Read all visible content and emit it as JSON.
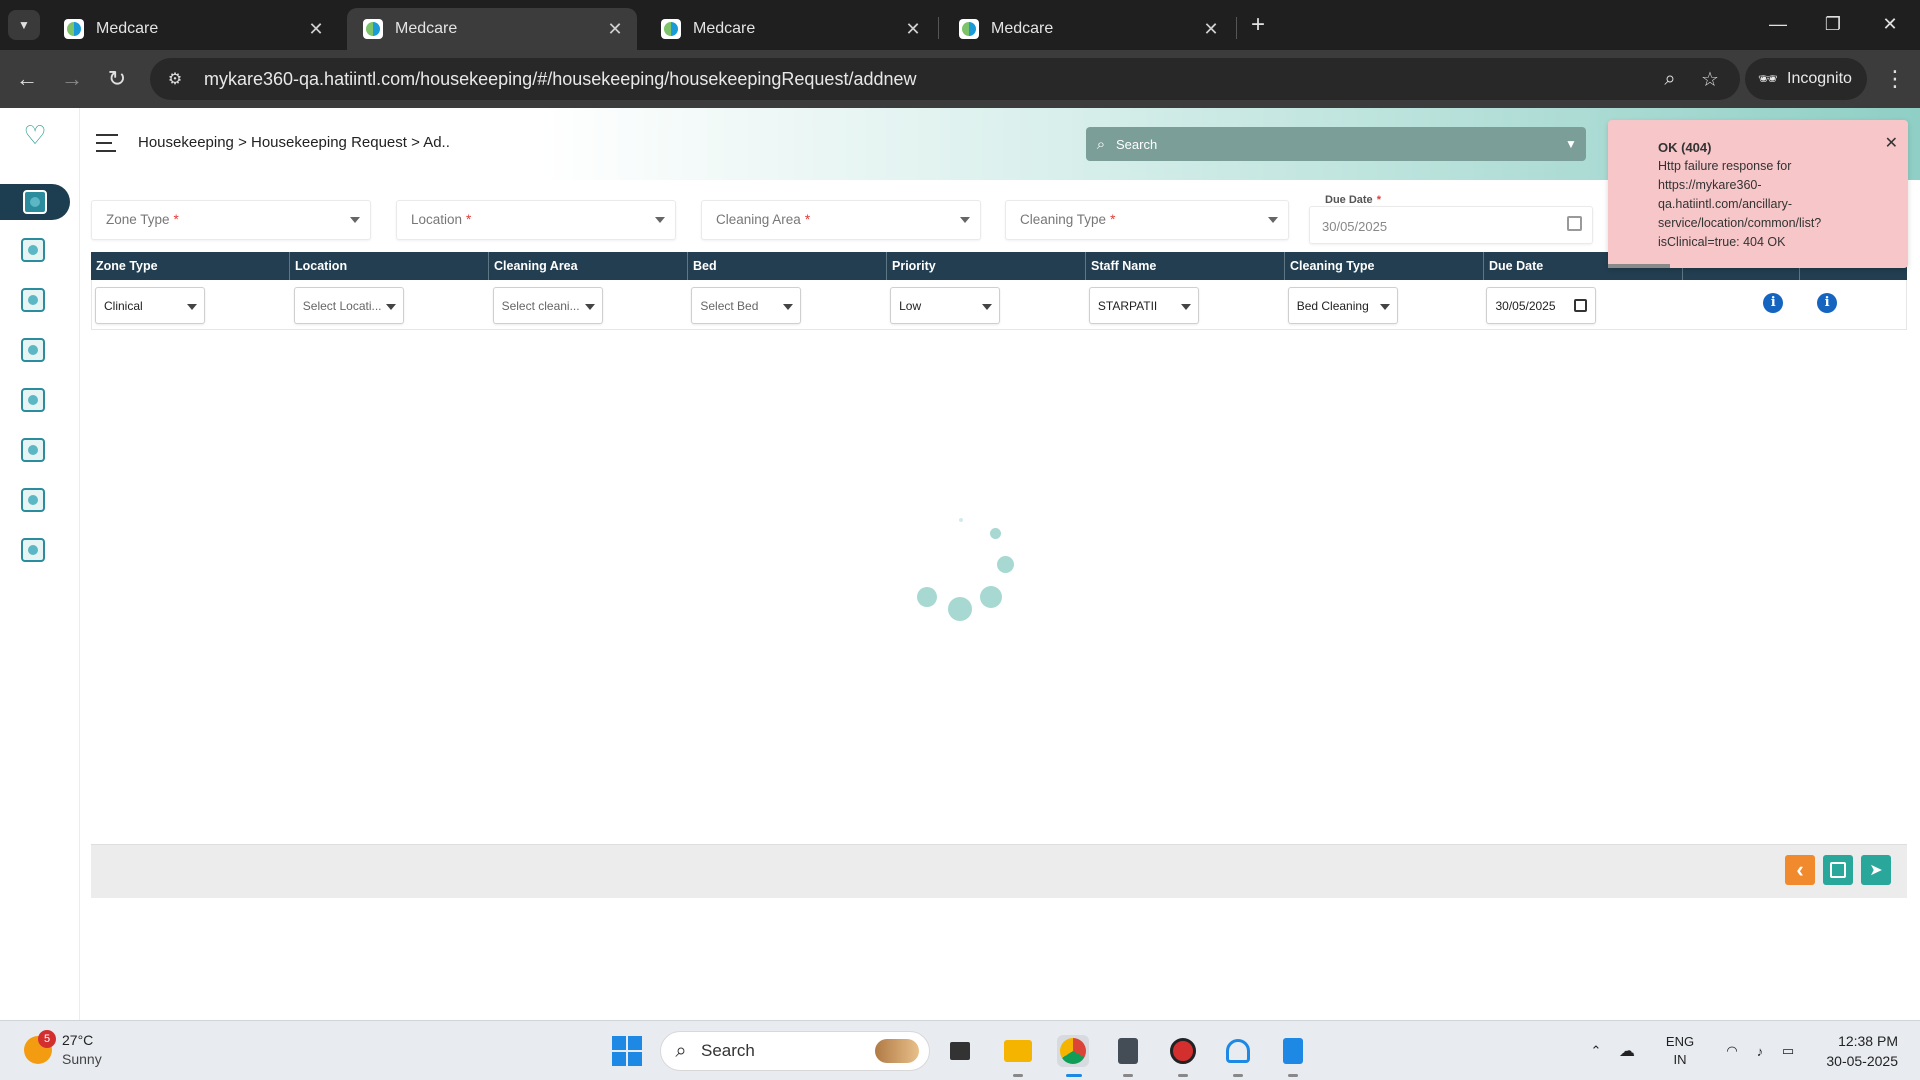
{
  "browser": {
    "tabs": [
      {
        "title": "Medcare",
        "active": false
      },
      {
        "title": "Medcare",
        "active": true
      },
      {
        "title": "Medcare",
        "active": false
      },
      {
        "title": "Medcare",
        "active": false
      }
    ],
    "url": "mykare360-qa.hatiintl.com/housekeeping/#/housekeeping/housekeepingRequest/addnew",
    "profile_label": "Incognito"
  },
  "header": {
    "breadcrumb": "Housekeeping > Housekeeping Request > Ad..",
    "search_placeholder": "Search"
  },
  "toast": {
    "title": "OK (404)",
    "message": "Http failure response for https://mykare360-qa.hatiintl.com/ancillary-service/location/common/list?isClinical=true: 404 OK",
    "color": "#f6c6c9"
  },
  "filters": {
    "zone_type": "Zone Type",
    "location": "Location",
    "cleaning_area": "Cleaning Area",
    "cleaning_type": "Cleaning Type",
    "due_date_label": "Due Date",
    "due_date_value": "30/05/2025",
    "required_mark": "*"
  },
  "table": {
    "columns": [
      "Zone Type",
      "Location",
      "Cleaning Area",
      "Bed",
      "Priority",
      "Staff Name",
      "Cleaning Type",
      "Due Date",
      "",
      ""
    ],
    "row": {
      "zone_type": "Clinical",
      "location": "Select Locati...",
      "cleaning_area": "Select cleani...",
      "bed": "Select Bed",
      "priority": "Low",
      "staff_name": "STARPATII",
      "cleaning_type": "Bed Cleaning",
      "due_date": "30/05/2025",
      "info_glyph": "i"
    }
  },
  "footer": {
    "back_glyph": "‹",
    "send_glyph": "➤"
  },
  "taskbar": {
    "weather_temp": "27°C",
    "weather_cond": "Sunny",
    "weather_badge": "5",
    "search_label": "Search",
    "lang_1": "ENG",
    "lang_2": "IN",
    "time": "12:38 PM",
    "date": "30-05-2025"
  },
  "colors": {
    "header_dark": "#223e50",
    "accent_teal": "#2aa79b",
    "back_orange": "#f08a2c",
    "info_blue": "#1565c0",
    "required_red": "#e53935"
  }
}
